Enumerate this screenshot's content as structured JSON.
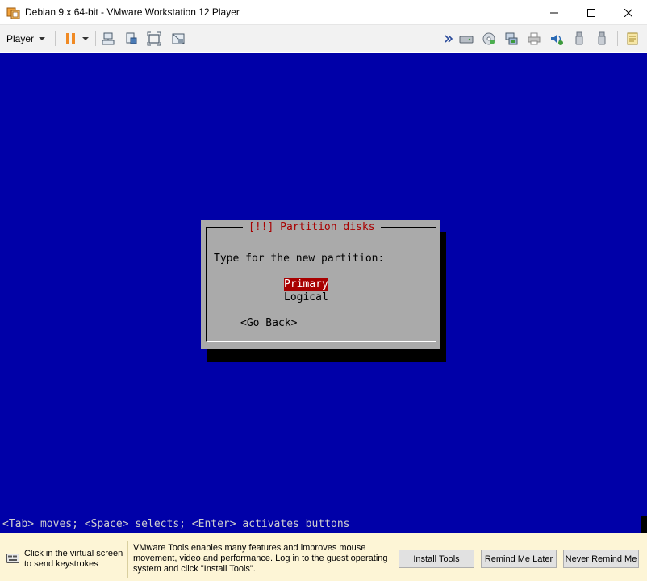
{
  "window": {
    "title": "Debian 9.x 64-bit - VMware Workstation 12 Player",
    "icons": [
      "vmware-app-icon",
      "minimize-icon",
      "maximize-icon",
      "close-icon"
    ]
  },
  "toolbar": {
    "player_label": "Player",
    "icons_left": [
      "pause-icon",
      "dropdown-caret-icon",
      "send-ctrl-alt-del-icon",
      "unity-icon",
      "fit-window-icon",
      "exit-fullscreen-icon"
    ],
    "icons_right": [
      "more-devices-icon",
      "hard-disk-icon",
      "cd-dvd-icon",
      "network-adapter-icon",
      "printer-icon",
      "sound-card-icon",
      "usb-device-icon",
      "usb-device-2-icon",
      "message-log-icon"
    ]
  },
  "guest": {
    "dialog_title": "[!!] Partition disks",
    "prompt": "Type for the new partition:",
    "options": [
      "Primary",
      "Logical"
    ],
    "selected_option": "Primary",
    "go_back": "<Go Back>",
    "help_line": "<Tab> moves; <Space> selects; <Enter> activates buttons",
    "colors": {
      "background": "#0000a8",
      "dialog": "#aaaaaa",
      "accent": "#a80000"
    }
  },
  "notification": {
    "click_hint": "Click in the virtual screen to send keystrokes",
    "tools_message": "VMware Tools enables many features and improves mouse movement, video and performance. Log in to the guest operating system and click \"Install Tools\".",
    "buttons": {
      "install": "Install Tools",
      "remind_later": "Remind Me Later",
      "never_remind": "Never Remind Me"
    }
  }
}
